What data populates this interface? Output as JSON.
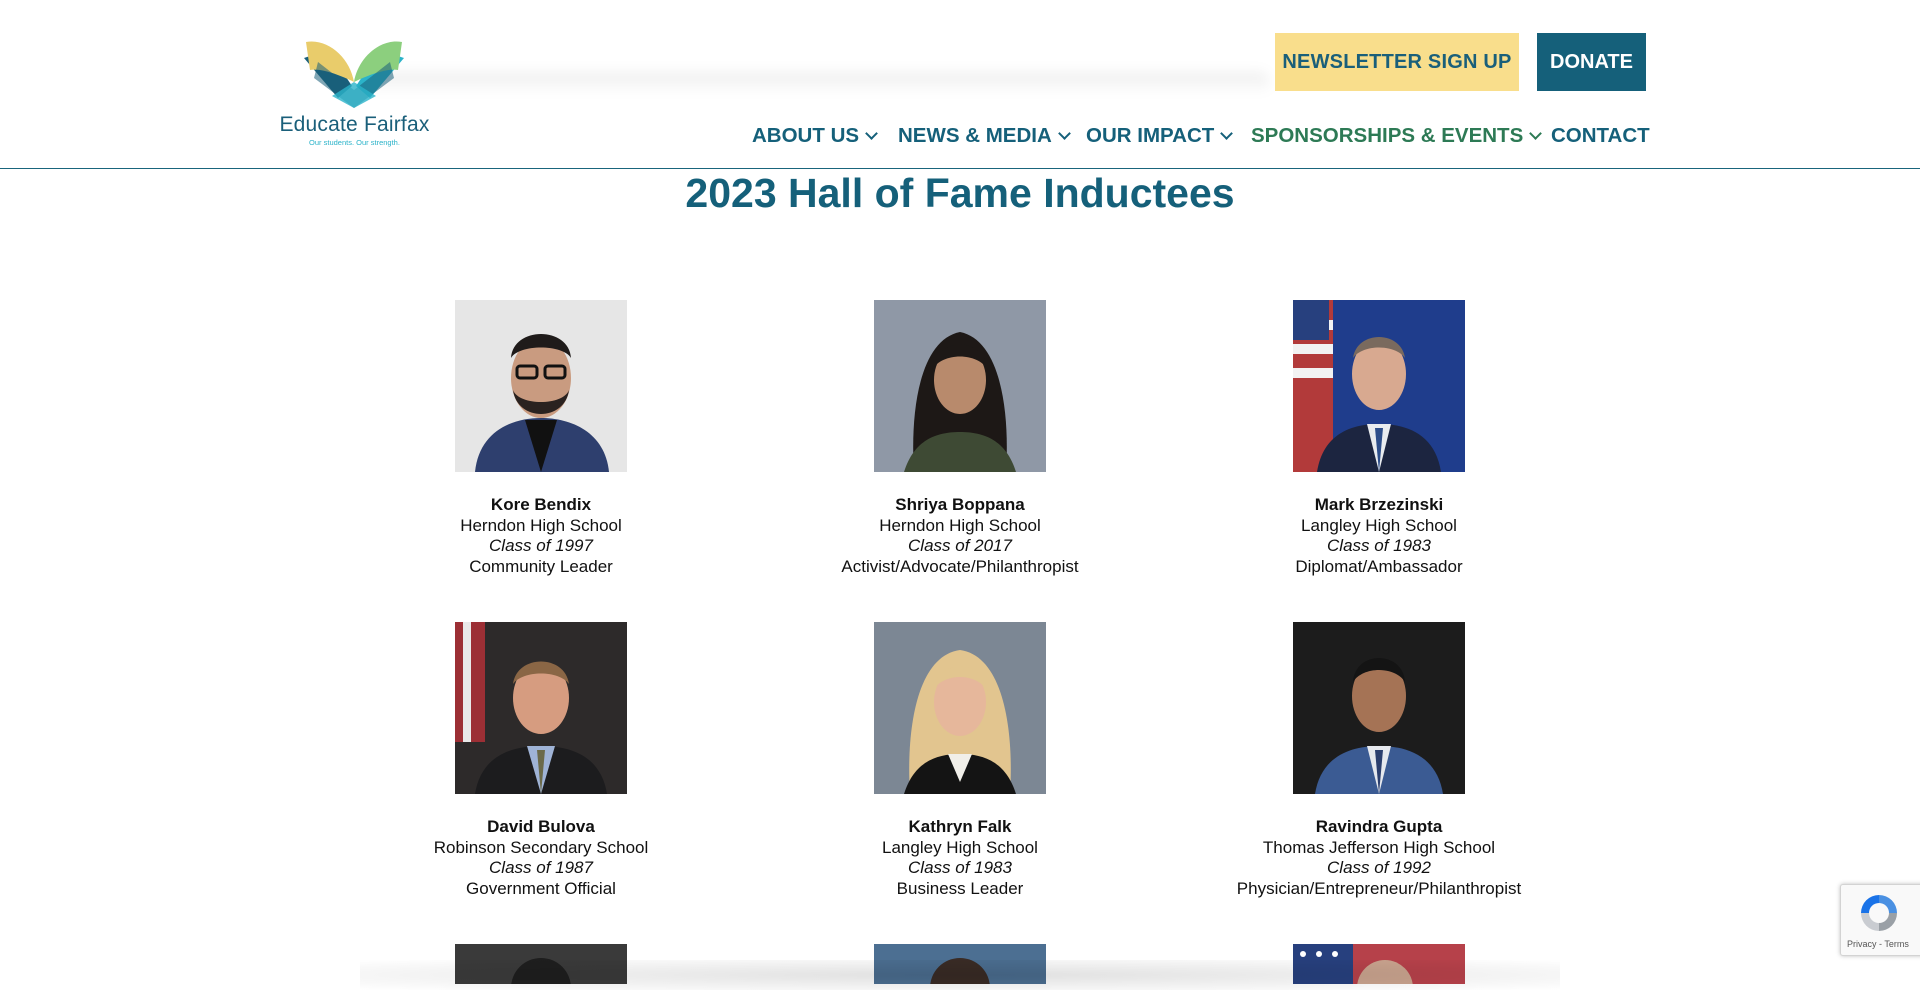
{
  "brand": {
    "name": "Educate Fairfax",
    "tagline": "Our students. Our strength."
  },
  "header": {
    "newsletter_label": "NEWSLETTER SIGN UP",
    "donate_label": "DONATE"
  },
  "nav": {
    "about": "ABOUT US",
    "news": "NEWS & MEDIA",
    "impact": "OUR IMPACT",
    "sponsorships": "SPONSORSHIPS & EVENTS",
    "contact": "CONTACT"
  },
  "page": {
    "title": "2023 Hall of Fame Inductees"
  },
  "inductees": [
    {
      "name": "Kore Bendix",
      "school": "Herndon High School",
      "class": "Class of 1997",
      "role": "Community Leader"
    },
    {
      "name": "Shriya Boppana",
      "school": "Herndon High School",
      "class": "Class of 2017",
      "role": "Activist/Advocate/Philanthropist"
    },
    {
      "name": "Mark Brzezinski",
      "school": "Langley High School",
      "class": "Class of 1983",
      "role": "Diplomat/Ambassador"
    },
    {
      "name": "David Bulova",
      "school": "Robinson Secondary School",
      "class": "Class of 1987",
      "role": "Government Official"
    },
    {
      "name": "Kathryn Falk",
      "school": "Langley High School",
      "class": "Class of 1983",
      "role": "Business Leader"
    },
    {
      "name": "Ravindra Gupta",
      "school": "Thomas Jefferson High School",
      "class": "Class of 1992",
      "role": "Physician/Entrepreneur/Philanthropist"
    }
  ],
  "recaptcha": {
    "terms": "Privacy - Terms"
  },
  "colors": {
    "primary": "#15607a",
    "nav_active": "#2d7a55",
    "newsletter_bg": "#f9de8c"
  },
  "icons": [
    "chevron-down-icon",
    "recaptcha-icon",
    "logo-book-icon"
  ]
}
